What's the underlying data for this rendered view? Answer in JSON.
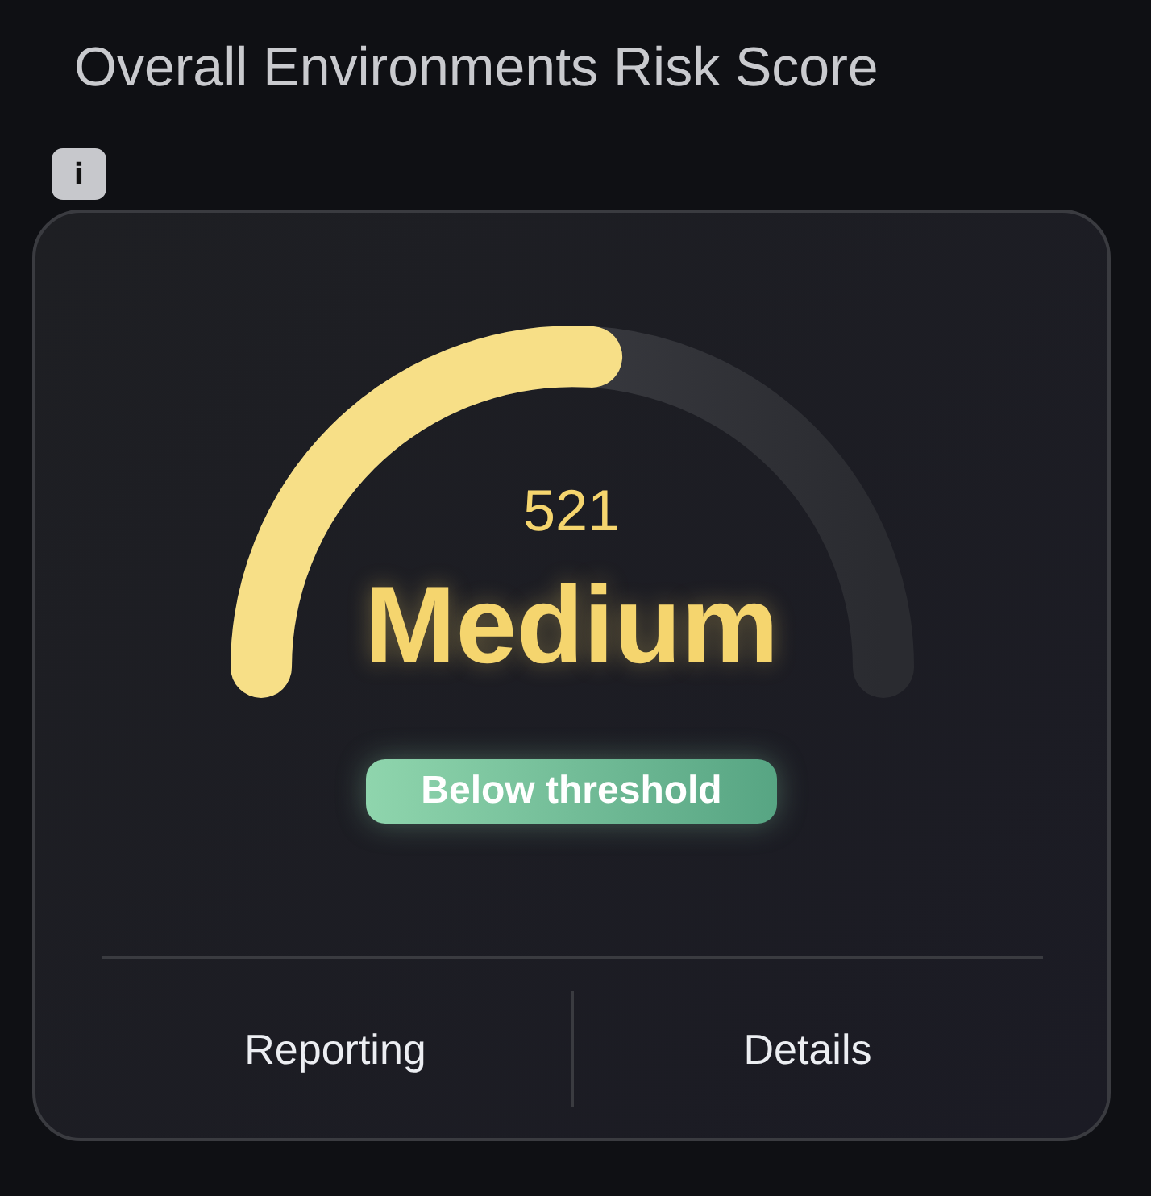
{
  "title": "Overall Environments Risk Score",
  "info_badge": "i",
  "gauge": {
    "score": "521",
    "rating": "Medium"
  },
  "status_badge": "Below threshold",
  "actions": [
    "Reporting",
    "Details"
  ]
}
